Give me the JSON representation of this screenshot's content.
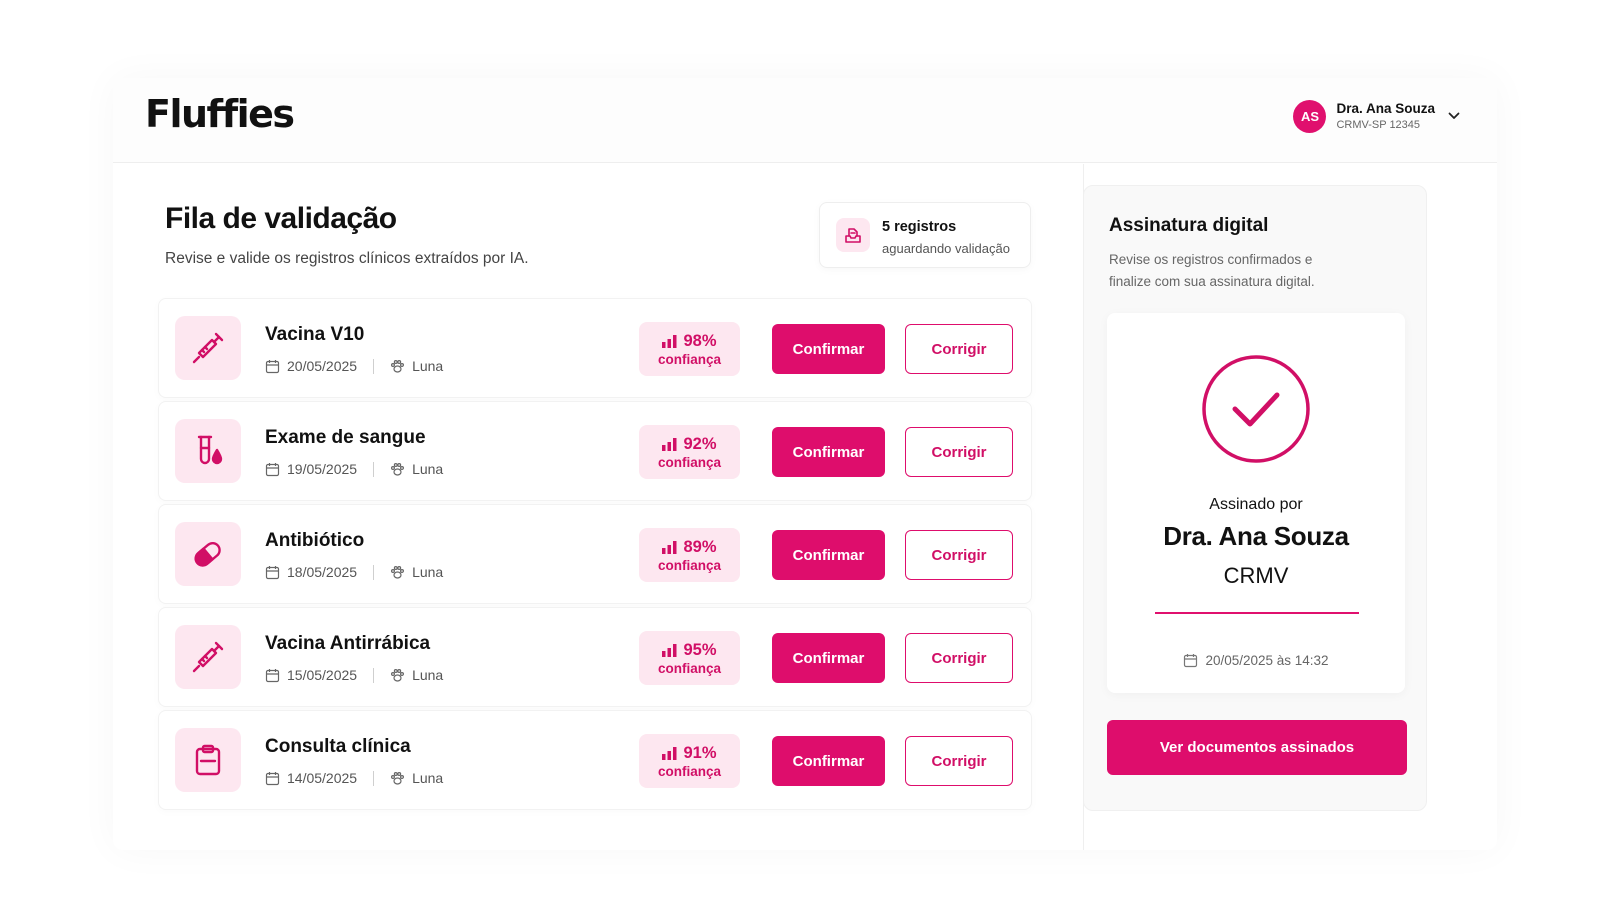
{
  "app": {
    "logo": "Fluffies"
  },
  "user": {
    "initials": "AS",
    "name": "Dra. Ana Souza",
    "registration": "CRMV-SP 12345"
  },
  "queue": {
    "title": "Fila de validação",
    "subtitle": "Revise e valide os registros clínicos extraídos por IA.",
    "count_value": "5 registros",
    "count_label": "aguardando validação",
    "confidence_label": "confiança",
    "confirm_label": "Confirmar",
    "fix_label": "Corrigir",
    "items": [
      {
        "title": "Vacina V10",
        "date": "20/05/2025",
        "pet": "Luna",
        "confidence": "98%",
        "icon": "syringe-icon"
      },
      {
        "title": "Exame de sangue",
        "date": "19/05/2025",
        "pet": "Luna",
        "confidence": "92%",
        "icon": "test-tube-icon"
      },
      {
        "title": "Antibiótico",
        "date": "18/05/2025",
        "pet": "Luna",
        "confidence": "89%",
        "icon": "pill-icon"
      },
      {
        "title": "Vacina Antirrábica",
        "date": "15/05/2025",
        "pet": "Luna",
        "confidence": "95%",
        "icon": "syringe-icon"
      },
      {
        "title": "Consulta clínica",
        "date": "14/05/2025",
        "pet": "Luna",
        "confidence": "91%",
        "icon": "clipboard-icon"
      }
    ]
  },
  "signature": {
    "title": "Assinatura digital",
    "description": "Revise os registros confirmados e finalize com sua assinatura digital.",
    "signed_by_label": "Assinado por",
    "signer_name": "Dra. Ana Souza",
    "signer_council": "CRMV",
    "signed_at": "20/05/2025 às 14:32",
    "button_label": "Ver documentos assinados"
  },
  "colors": {
    "accent": "#de0d6c",
    "accent_soft": "#fde7f0",
    "text": "#111111",
    "muted": "#666666"
  }
}
